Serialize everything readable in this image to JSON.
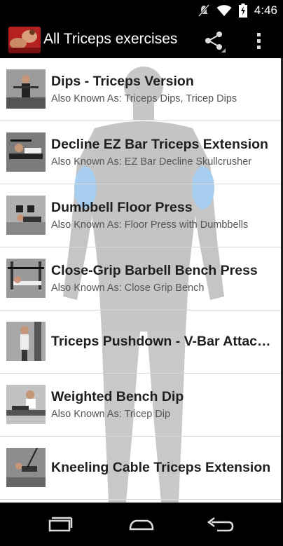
{
  "status_bar": {
    "time": "4:46"
  },
  "action_bar": {
    "title": "All Triceps exercises"
  },
  "exercises": [
    {
      "title": "Dips - Triceps Version",
      "aka": "Also Known As: Triceps Dips, Tricep Dips"
    },
    {
      "title": "Decline EZ Bar Triceps Extension",
      "aka": "Also Known As: EZ Bar Decline Skullcrusher"
    },
    {
      "title": "Dumbbell Floor Press",
      "aka": "Also Known As: Floor Press with Dumbbells"
    },
    {
      "title": "Close-Grip Barbell Bench Press",
      "aka": "Also Known As: Close Grip Bench"
    },
    {
      "title": "Triceps Pushdown - V-Bar Attach...",
      "aka": ""
    },
    {
      "title": "Weighted Bench Dip",
      "aka": "Also Known As: Tricep Dip"
    },
    {
      "title": "Kneeling Cable Triceps Extension",
      "aka": ""
    }
  ],
  "colors": {
    "accent": "#3f9fe0",
    "title_text": "#1e1e1e",
    "subtitle_text": "#555555",
    "bar": "#000000"
  },
  "icons": {
    "share": "share-icon",
    "overflow": "overflow-menu-icon",
    "back": "back-icon",
    "home": "home-icon",
    "recents": "recent-apps-icon"
  }
}
